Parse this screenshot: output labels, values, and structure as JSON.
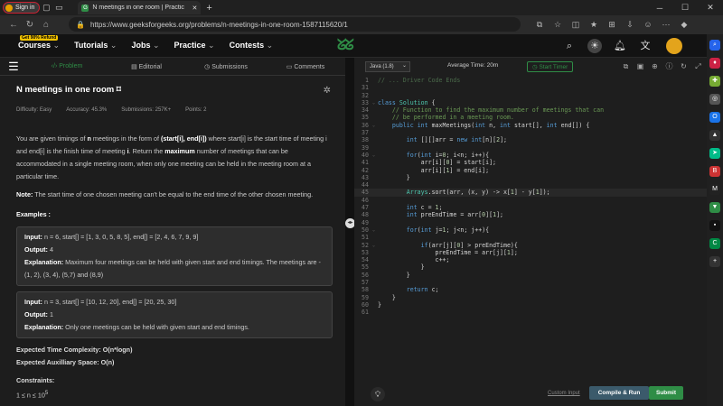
{
  "browser": {
    "signin": "Sign in",
    "tab_title": "N meetings in one room | Practic",
    "url": "https://www.geeksforgeeks.org/problems/n-meetings-in-one-room-1587115620/1"
  },
  "header": {
    "badge": "Get 90% Refund",
    "menu": [
      "Courses",
      "Tutorials",
      "Jobs",
      "Practice",
      "Contests"
    ],
    "logo": "GfG"
  },
  "left": {
    "tabs": [
      "Problem",
      "Editorial",
      "Submissions",
      "Comments"
    ],
    "title": "N meetings in one room",
    "difficulty": "Difficulty: Easy",
    "accuracy": "Accuracy: 45.3%",
    "submissions": "Submissions: 257K+",
    "points": "Points: 2",
    "desc1": "You are given timings of ",
    "desc_n": "n",
    "desc2": " meetings in the form of ",
    "desc_pair": "(start[i], end[i])",
    "desc3": " where start[i] is the start time of meeting i and end[i] is the finish time of meeting ",
    "desc_i": "i",
    "desc4": ". Return the ",
    "desc_max": "maximum",
    "desc5": " number of meetings that can be accommodated in a single meeting room, when only one meeting can be held in the meeting room at a particular time.",
    "note_label": "Note:",
    "note": " The start time of one chosen meeting can't be equal to the end time of the other chosen meeting.",
    "examples_label": "Examples :",
    "ex1_input": "n = 6, start[] = [1, 3, 0, 5, 8, 5], end[] = [2, 4, 6, 7, 9, 9]",
    "ex1_output": "4",
    "ex1_expl": "Maximum four meetings can be held with given start and end timings. The meetings are - (1, 2), (3, 4), (5,7) and (8,9)",
    "ex2_input": "n = 3, start[] = [10, 12, 20], end[] = [20, 25, 30]",
    "ex2_output": "1",
    "ex2_expl": "Only one meetings can be held with given start and end timings.",
    "input_label": "Input:",
    "output_label": "Output:",
    "expl_label": "Explanation:",
    "etc": "Expected Time Complexity: O(n*logn)",
    "eas": "Expected Auxilliary Space: O(n)",
    "constraints": "Constraints:",
    "c1": "1 ≤ n ≤ 10",
    "c1_exp": "5"
  },
  "editor": {
    "language": "Java (1.8)",
    "avg_time": "Average Time: 20m",
    "start_timer": "Start Timer",
    "custom_input": "Custom Input",
    "compile_run": "Compile & Run",
    "submit": "Submit"
  },
  "code_lines": [
    {
      "no": "1",
      "t": "// ... Driver Code Ends"
    },
    {
      "no": "31",
      "t": ""
    },
    {
      "no": "32",
      "t": ""
    },
    {
      "no": "33",
      "t": "class Solution {"
    },
    {
      "no": "34",
      "t": "    // Function to find the maximum number of meetings that can"
    },
    {
      "no": "35",
      "t": "    // be performed in a meeting room."
    },
    {
      "no": "36",
      "t": "    public int maxMeetings(int n, int start[], int end[]) {"
    },
    {
      "no": "37",
      "t": ""
    },
    {
      "no": "38",
      "t": "        int [][]arr = new int[n][2];"
    },
    {
      "no": "39",
      "t": ""
    },
    {
      "no": "40",
      "t": "        for(int i=0; i<n; i++){"
    },
    {
      "no": "41",
      "t": "            arr[i][0] = start[i];"
    },
    {
      "no": "42",
      "t": "            arr[i][1] = end[i];"
    },
    {
      "no": "43",
      "t": "        }"
    },
    {
      "no": "44",
      "t": ""
    },
    {
      "no": "45",
      "t": "        Arrays.sort(arr, (x, y) -> x[1] - y[1]);"
    },
    {
      "no": "46",
      "t": ""
    },
    {
      "no": "47",
      "t": "        int c = 1;"
    },
    {
      "no": "48",
      "t": "        int preEndTime = arr[0][1];"
    },
    {
      "no": "49",
      "t": ""
    },
    {
      "no": "50",
      "t": "        for(int j=1; j<n; j++){"
    },
    {
      "no": "51",
      "t": ""
    },
    {
      "no": "52",
      "t": "            if(arr[j][0] > preEndTime){"
    },
    {
      "no": "53",
      "t": "                preEndTime = arr[j][1];"
    },
    {
      "no": "54",
      "t": "                c++;"
    },
    {
      "no": "55",
      "t": "            }"
    },
    {
      "no": "56",
      "t": "        }"
    },
    {
      "no": "57",
      "t": ""
    },
    {
      "no": "58",
      "t": "        return c;"
    },
    {
      "no": "59",
      "t": "    }"
    },
    {
      "no": "60",
      "t": "}"
    },
    {
      "no": "61",
      "t": ""
    }
  ]
}
